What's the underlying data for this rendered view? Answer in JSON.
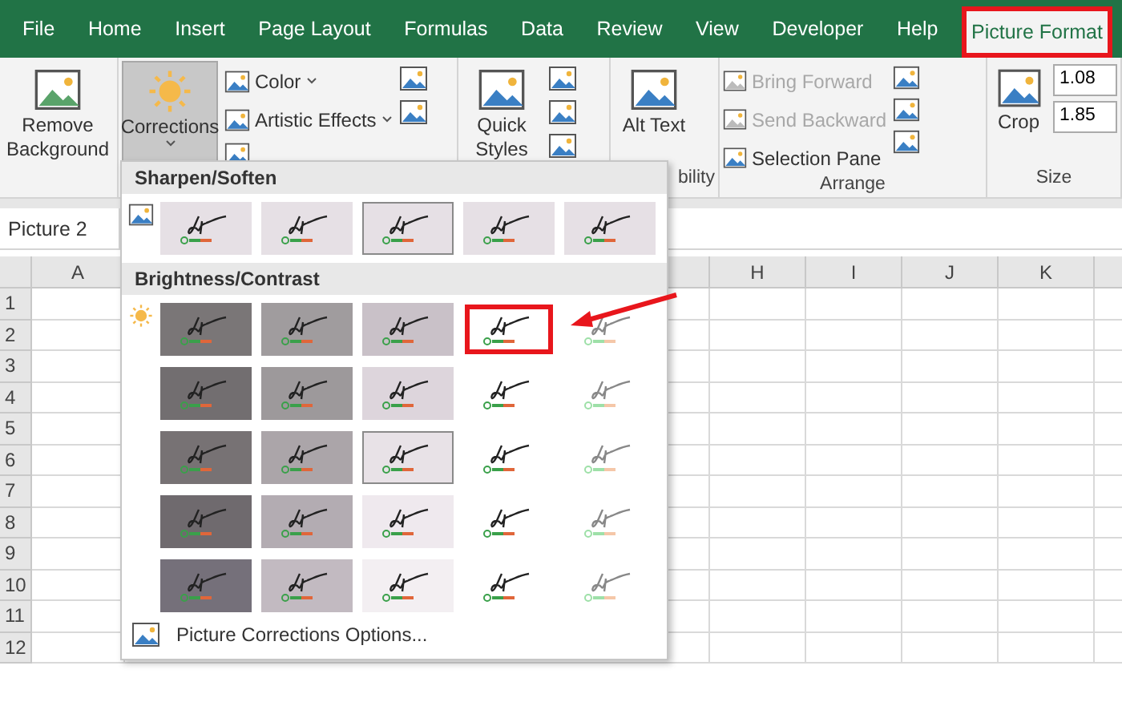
{
  "tabs": [
    {
      "label": "File",
      "selected": false,
      "marked": false
    },
    {
      "label": "Home",
      "selected": false,
      "marked": false
    },
    {
      "label": "Insert",
      "selected": false,
      "marked": false
    },
    {
      "label": "Page Layout",
      "selected": false,
      "marked": false
    },
    {
      "label": "Formulas",
      "selected": false,
      "marked": false
    },
    {
      "label": "Data",
      "selected": false,
      "marked": false
    },
    {
      "label": "Review",
      "selected": false,
      "marked": false
    },
    {
      "label": "View",
      "selected": false,
      "marked": false
    },
    {
      "label": "Developer",
      "selected": false,
      "marked": false
    },
    {
      "label": "Help",
      "selected": false,
      "marked": false
    },
    {
      "label": "Picture Format",
      "selected": true,
      "marked": true
    }
  ],
  "ribbon": {
    "remove_background": "Remove Background",
    "corrections": {
      "label": "Corrections",
      "pressed": true
    },
    "adjust": [
      "Color",
      "Artistic Effects"
    ],
    "quick_styles": "Quick Styles",
    "alt_text": "Alt Text",
    "accessibility_label": "bility",
    "arrange": [
      {
        "label": "Bring Forward",
        "disabled": true
      },
      {
        "label": "Send Backward",
        "disabled": true
      },
      {
        "label": "Selection Pane",
        "disabled": false
      }
    ],
    "arrange_label": "Arrange",
    "crop": "Crop",
    "size_fields": [
      "1.08",
      "1.85"
    ],
    "size_label": "Size"
  },
  "name_box": "Picture 2",
  "columns": [
    "A",
    "H",
    "I",
    "J",
    "K"
  ],
  "rows": [
    "1",
    "2",
    "3",
    "4",
    "5",
    "6",
    "7",
    "8",
    "9",
    "10",
    "11",
    "12"
  ],
  "corrections_menu": {
    "sections": [
      {
        "title": "Sharpen/Soften",
        "kind": "sharpen",
        "rows": [
          [
            {
              "color": "#e6e0e5",
              "selected": false,
              "marked": false
            },
            {
              "color": "#e6e0e5",
              "selected": false,
              "marked": false
            },
            {
              "color": "#e6e0e5",
              "selected": true,
              "marked": false
            },
            {
              "color": "#e6e0e5",
              "selected": false,
              "marked": false
            },
            {
              "color": "#e6e0e5",
              "selected": false,
              "marked": false
            }
          ]
        ]
      },
      {
        "title": "Brightness/Contrast",
        "kind": "brightness",
        "rows": [
          [
            {
              "color": "#7a7677",
              "selected": false,
              "marked": false
            },
            {
              "color": "#a09c9e",
              "selected": false,
              "marked": false
            },
            {
              "color": "#c9c1c8",
              "selected": false,
              "marked": false
            },
            {
              "color": "#ffffff",
              "selected": false,
              "marked": true
            },
            {
              "color": "#ffffff",
              "selected": false,
              "marked": false
            }
          ],
          [
            {
              "color": "#726e70",
              "selected": false,
              "marked": false
            },
            {
              "color": "#9d999b",
              "selected": false,
              "marked": false
            },
            {
              "color": "#ddd5dc",
              "selected": false,
              "marked": false
            },
            {
              "color": "#ffffff",
              "selected": false,
              "marked": false
            },
            {
              "color": "#ffffff",
              "selected": false,
              "marked": false
            }
          ],
          [
            {
              "color": "#777274",
              "selected": false,
              "marked": false
            },
            {
              "color": "#aba5a9",
              "selected": false,
              "marked": false
            },
            {
              "color": "#e8e2e7",
              "selected": true,
              "marked": false
            },
            {
              "color": "#ffffff",
              "selected": false,
              "marked": false
            },
            {
              "color": "#ffffff",
              "selected": false,
              "marked": false
            }
          ],
          [
            {
              "color": "#6f6a6e",
              "selected": false,
              "marked": false
            },
            {
              "color": "#b3acb2",
              "selected": false,
              "marked": false
            },
            {
              "color": "#efe9ee",
              "selected": false,
              "marked": false
            },
            {
              "color": "#ffffff",
              "selected": false,
              "marked": false
            },
            {
              "color": "#ffffff",
              "selected": false,
              "marked": false
            }
          ],
          [
            {
              "color": "#75707a",
              "selected": false,
              "marked": false
            },
            {
              "color": "#c2bac1",
              "selected": false,
              "marked": false
            },
            {
              "color": "#f3eff2",
              "selected": false,
              "marked": false
            },
            {
              "color": "#ffffff",
              "selected": false,
              "marked": false
            },
            {
              "color": "#ffffff",
              "selected": false,
              "marked": false
            }
          ]
        ]
      }
    ],
    "options_link": "Picture Corrections Options..."
  }
}
